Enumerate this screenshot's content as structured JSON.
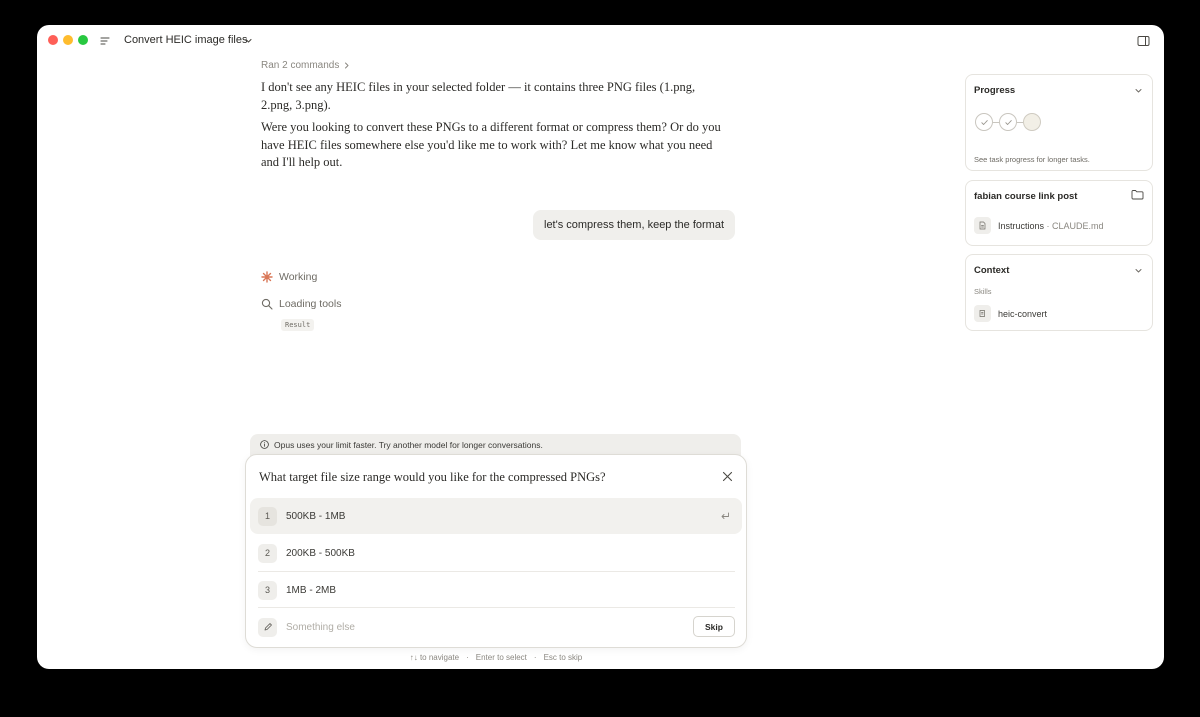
{
  "window": {
    "title": "Convert HEIC image files"
  },
  "chat": {
    "ran_commands": "Ran 2 commands",
    "assistant_msg_1": "I don't see any HEIC files in your selected folder — it contains three PNG files (1.png, 2.png, 3.png).",
    "assistant_msg_2": "Were you looking to convert these PNGs to a different format or compress them? Or do you have HEIC files somewhere else you'd like me to work with? Let me know what you need and I'll help out.",
    "user_msg": "let's compress them, keep the format",
    "working_label": "Working",
    "loading_label": "Loading tools",
    "result_chip": "Result"
  },
  "notice": {
    "text": "Opus uses your limit faster. Try another model for longer conversations."
  },
  "question": {
    "text": "What target file size range would you like for the compressed PNGs?",
    "options": [
      {
        "num": "1",
        "label": "500KB - 1MB"
      },
      {
        "num": "2",
        "label": "200KB - 500KB"
      },
      {
        "num": "3",
        "label": "1MB - 2MB"
      }
    ],
    "other_placeholder": "Something else",
    "skip_label": "Skip"
  },
  "hints": {
    "navigate": "↑↓ to navigate",
    "select": "Enter to select",
    "skip": "Esc to skip",
    "separator": "·"
  },
  "panels": {
    "progress": {
      "title": "Progress",
      "subtitle": "See task progress for longer tasks."
    },
    "project": {
      "title": "fabian course link post",
      "file_label": "Instructions",
      "file_meta": "· CLAUDE.md"
    },
    "context": {
      "title": "Context",
      "skills_label": "Skills",
      "skill_name": "heic-convert"
    }
  },
  "icons": {
    "working": "sparkle-icon",
    "loading": "search-icon",
    "close": "close-icon",
    "enter": "enter-icon",
    "pencil": "pencil-icon"
  },
  "colors": {
    "accent_sparkle": "#d97757",
    "traffic_red": "#fe5f57",
    "traffic_yellow": "#febc2e",
    "traffic_green": "#28c840"
  }
}
